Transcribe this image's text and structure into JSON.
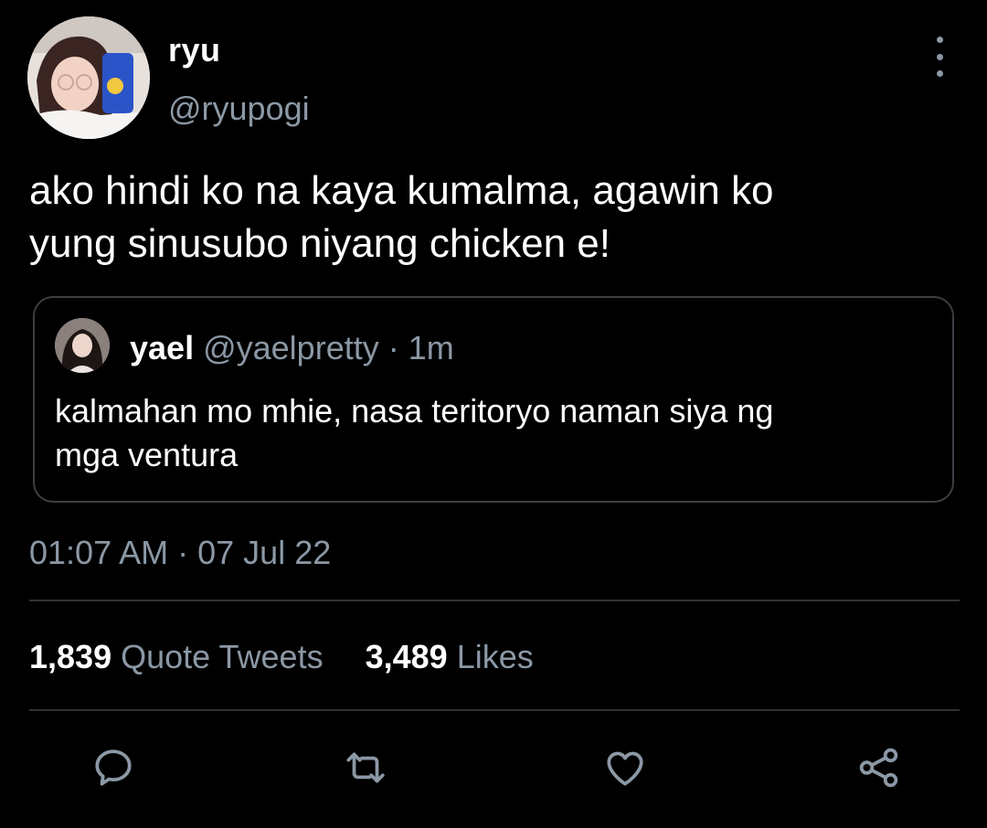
{
  "author": {
    "display_name": "ryu",
    "handle": "@ryupogi"
  },
  "tweet": {
    "text_lines": [
      "ako hindi ko na kaya kumalma, agawin ko",
      "yung sinusubo niyang chicken e!"
    ],
    "timestamp_time": "01:07 AM",
    "timestamp_sep": "·",
    "timestamp_date": "07 Jul 22"
  },
  "quoted_tweet": {
    "display_name": "yael",
    "handle": "@yaelpretty",
    "separator": "·",
    "time": "1m",
    "text_lines": [
      "kalmahan mo mhie, nasa teritoryo naman siya ng",
      "mga ventura"
    ]
  },
  "stats": {
    "quote_tweets_count": "1,839",
    "quote_tweets_label": "Quote Tweets",
    "likes_count": "3,489",
    "likes_label": "Likes"
  },
  "actions": [
    "reply-icon",
    "retweet-icon",
    "like-icon",
    "share-icon"
  ],
  "colors": {
    "background": "#000000",
    "text_primary": "#ffffff",
    "text_secondary": "#8b98a5",
    "border": "#2f3336"
  }
}
